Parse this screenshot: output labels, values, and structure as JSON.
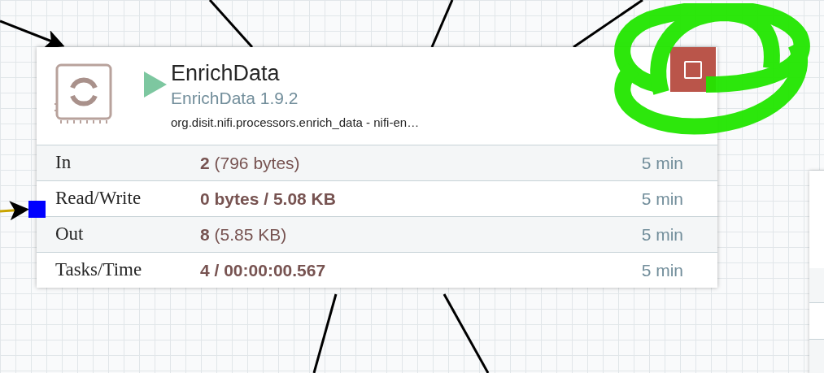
{
  "processor": {
    "name": "EnrichData",
    "version": "EnrichData 1.9.2",
    "bundle": "org.disit.nifi.processors.enrich_data - nifi-en…",
    "running": true,
    "has_bulletin": true,
    "stats": [
      {
        "label": "In",
        "value": "**2** (796 bytes)",
        "bold_all": false,
        "window": "5 min"
      },
      {
        "label": "Read/Write",
        "value": "0 bytes / 5.08 KB",
        "bold_all": true,
        "window": "5 min"
      },
      {
        "label": "Out",
        "value": "**8** (5.85 KB)",
        "bold_all": false,
        "window": "5 min"
      },
      {
        "label": "Tasks/Time",
        "value": "4 / 00:00:00.567",
        "bold_all": true,
        "window": "5 min"
      }
    ]
  }
}
